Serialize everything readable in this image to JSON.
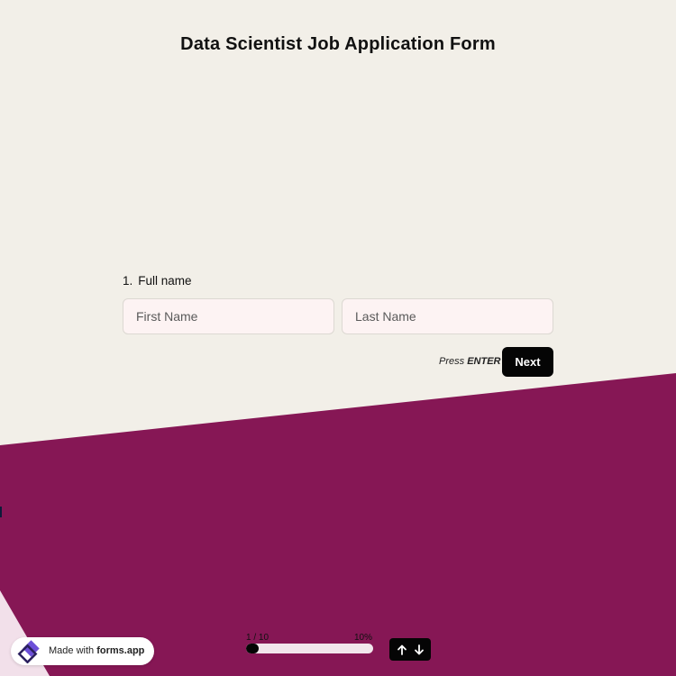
{
  "form": {
    "title": "Data Scientist Job Application Form"
  },
  "question": {
    "number": "1.",
    "label": "Full name",
    "first_name_placeholder": "First Name",
    "last_name_placeholder": "Last Name"
  },
  "actions": {
    "press_hint_prefix": "Press",
    "press_hint_key": "ENTER",
    "next_label": "Next"
  },
  "progress": {
    "count": "1 / 10",
    "percent_label": "10%",
    "fraction": 0.1
  },
  "branding": {
    "prefix": "Made with",
    "name": "forms.app"
  },
  "icons": {
    "up": "arrow-up-icon",
    "down": "arrow-down-icon",
    "logo": "forms-app-logo-icon"
  },
  "colors": {
    "background": "#f2efe8",
    "accent_band": "#861755",
    "button": "#050505",
    "field_bg": "#fdf3f3"
  }
}
